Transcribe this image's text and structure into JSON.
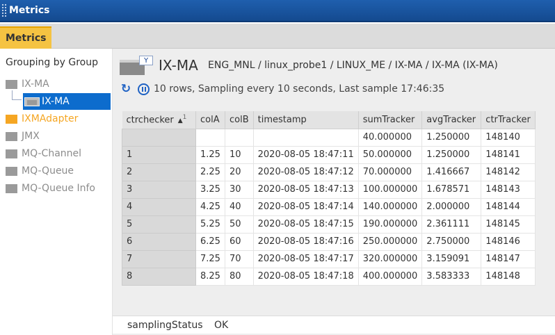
{
  "window": {
    "title": "Metrics"
  },
  "tabs": [
    {
      "label": "Metrics",
      "active": true
    }
  ],
  "sidebar": {
    "heading": "Grouping by Group",
    "items": [
      {
        "label": "IX-MA",
        "icon": "folder-icon"
      },
      {
        "label": "IX-MA",
        "icon": "entity-icon",
        "selected": true
      },
      {
        "label": "IXMAdapter",
        "icon": "folder-icon",
        "highlight": true
      },
      {
        "label": "JMX",
        "icon": "folder-icon"
      },
      {
        "label": "MQ-Channel",
        "icon": "folder-icon"
      },
      {
        "label": "MQ-Queue",
        "icon": "folder-icon"
      },
      {
        "label": "MQ-Queue Info",
        "icon": "folder-icon"
      }
    ]
  },
  "header": {
    "entity_name": "IX-MA",
    "path": "ENG_MNL / linux_probe1 / LINUX_ME / IX-MA / IX-MA (IX-MA)",
    "filter_icon": "Y"
  },
  "status": {
    "text": "10 rows, Sampling every 10 seconds, Last sample 17:46:35",
    "refresh_glyph": "↻"
  },
  "table": {
    "columns": [
      "ctrchecker",
      "colA",
      "colB",
      "timestamp",
      "sumTracker",
      "avgTracker",
      "ctrTracker"
    ],
    "sort": {
      "arrow": "▲",
      "index": "1"
    },
    "rows": [
      [
        "",
        "",
        "",
        "",
        "40.000000",
        "1.250000",
        "148140"
      ],
      [
        "1",
        "1.25",
        "10",
        "2020-08-05 18:47:11",
        "50.000000",
        "1.250000",
        "148141"
      ],
      [
        "2",
        "2.25",
        "20",
        "2020-08-05 18:47:12",
        "70.000000",
        "1.416667",
        "148142"
      ],
      [
        "3",
        "3.25",
        "30",
        "2020-08-05 18:47:13",
        "100.000000",
        "1.678571",
        "148143"
      ],
      [
        "4",
        "4.25",
        "40",
        "2020-08-05 18:47:14",
        "140.000000",
        "2.000000",
        "148144"
      ],
      [
        "5",
        "5.25",
        "50",
        "2020-08-05 18:47:15",
        "190.000000",
        "2.361111",
        "148145"
      ],
      [
        "6",
        "6.25",
        "60",
        "2020-08-05 18:47:16",
        "250.000000",
        "2.750000",
        "148146"
      ],
      [
        "7",
        "7.25",
        "70",
        "2020-08-05 18:47:17",
        "320.000000",
        "3.159091",
        "148147"
      ],
      [
        "8",
        "8.25",
        "80",
        "2020-08-05 18:47:18",
        "400.000000",
        "3.583333",
        "148148"
      ]
    ]
  },
  "footer": {
    "key": "samplingStatus",
    "value": "OK"
  },
  "colors": {
    "titlebar": "#1a56a0",
    "active_tab": "#f5c342",
    "selection": "#0d6ccd",
    "highlight_text": "#f5a623"
  }
}
